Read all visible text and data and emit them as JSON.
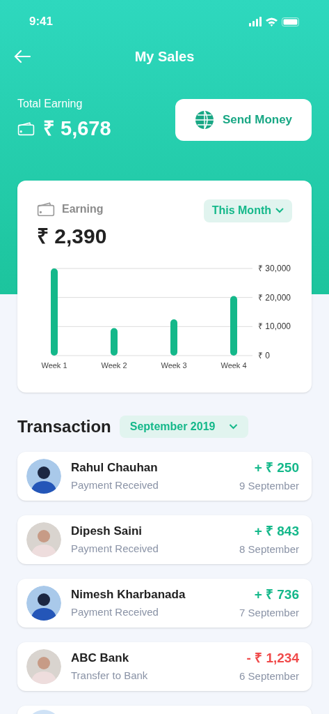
{
  "status_bar": {
    "time": "9:41"
  },
  "header": {
    "title": "My Sales"
  },
  "total": {
    "label": "Total Earning",
    "amount": "₹ 5,678"
  },
  "send_button": {
    "label": "Send Money"
  },
  "earning_card": {
    "label": "Earning",
    "amount": "₹ 2,390",
    "period": "This Month",
    "chart_data": {
      "type": "bar",
      "categories": [
        "Week 1",
        "Week 2",
        "Week 3",
        "Week 4"
      ],
      "values": [
        30000,
        9500,
        12500,
        20500
      ],
      "ylim": [
        0,
        30000
      ],
      "yticks": [
        {
          "value": 0,
          "label": "₹ 0"
        },
        {
          "value": 10000,
          "label": "₹ 10,000"
        },
        {
          "value": 20000,
          "label": "₹ 20,000"
        },
        {
          "value": 30000,
          "label": "₹ 30,000"
        }
      ]
    }
  },
  "transactions": {
    "title": "Transaction",
    "period": "September 2019",
    "items": [
      {
        "name": "Rahul Chauhan",
        "note": "Payment Received",
        "amount": "+ ₹ 250",
        "date": "9 September",
        "kind": "credit"
      },
      {
        "name": "Dipesh Saini",
        "note": "Payment Received",
        "amount": "+ ₹ 843",
        "date": "8 September",
        "kind": "credit"
      },
      {
        "name": "Nimesh Kharbanada",
        "note": "Payment Received",
        "amount": "+ ₹ 736",
        "date": "7 September",
        "kind": "credit"
      },
      {
        "name": "ABC Bank",
        "note": "Transfer to Bank",
        "amount": "- ₹ 1,234",
        "date": "6 September",
        "kind": "debit"
      }
    ]
  }
}
